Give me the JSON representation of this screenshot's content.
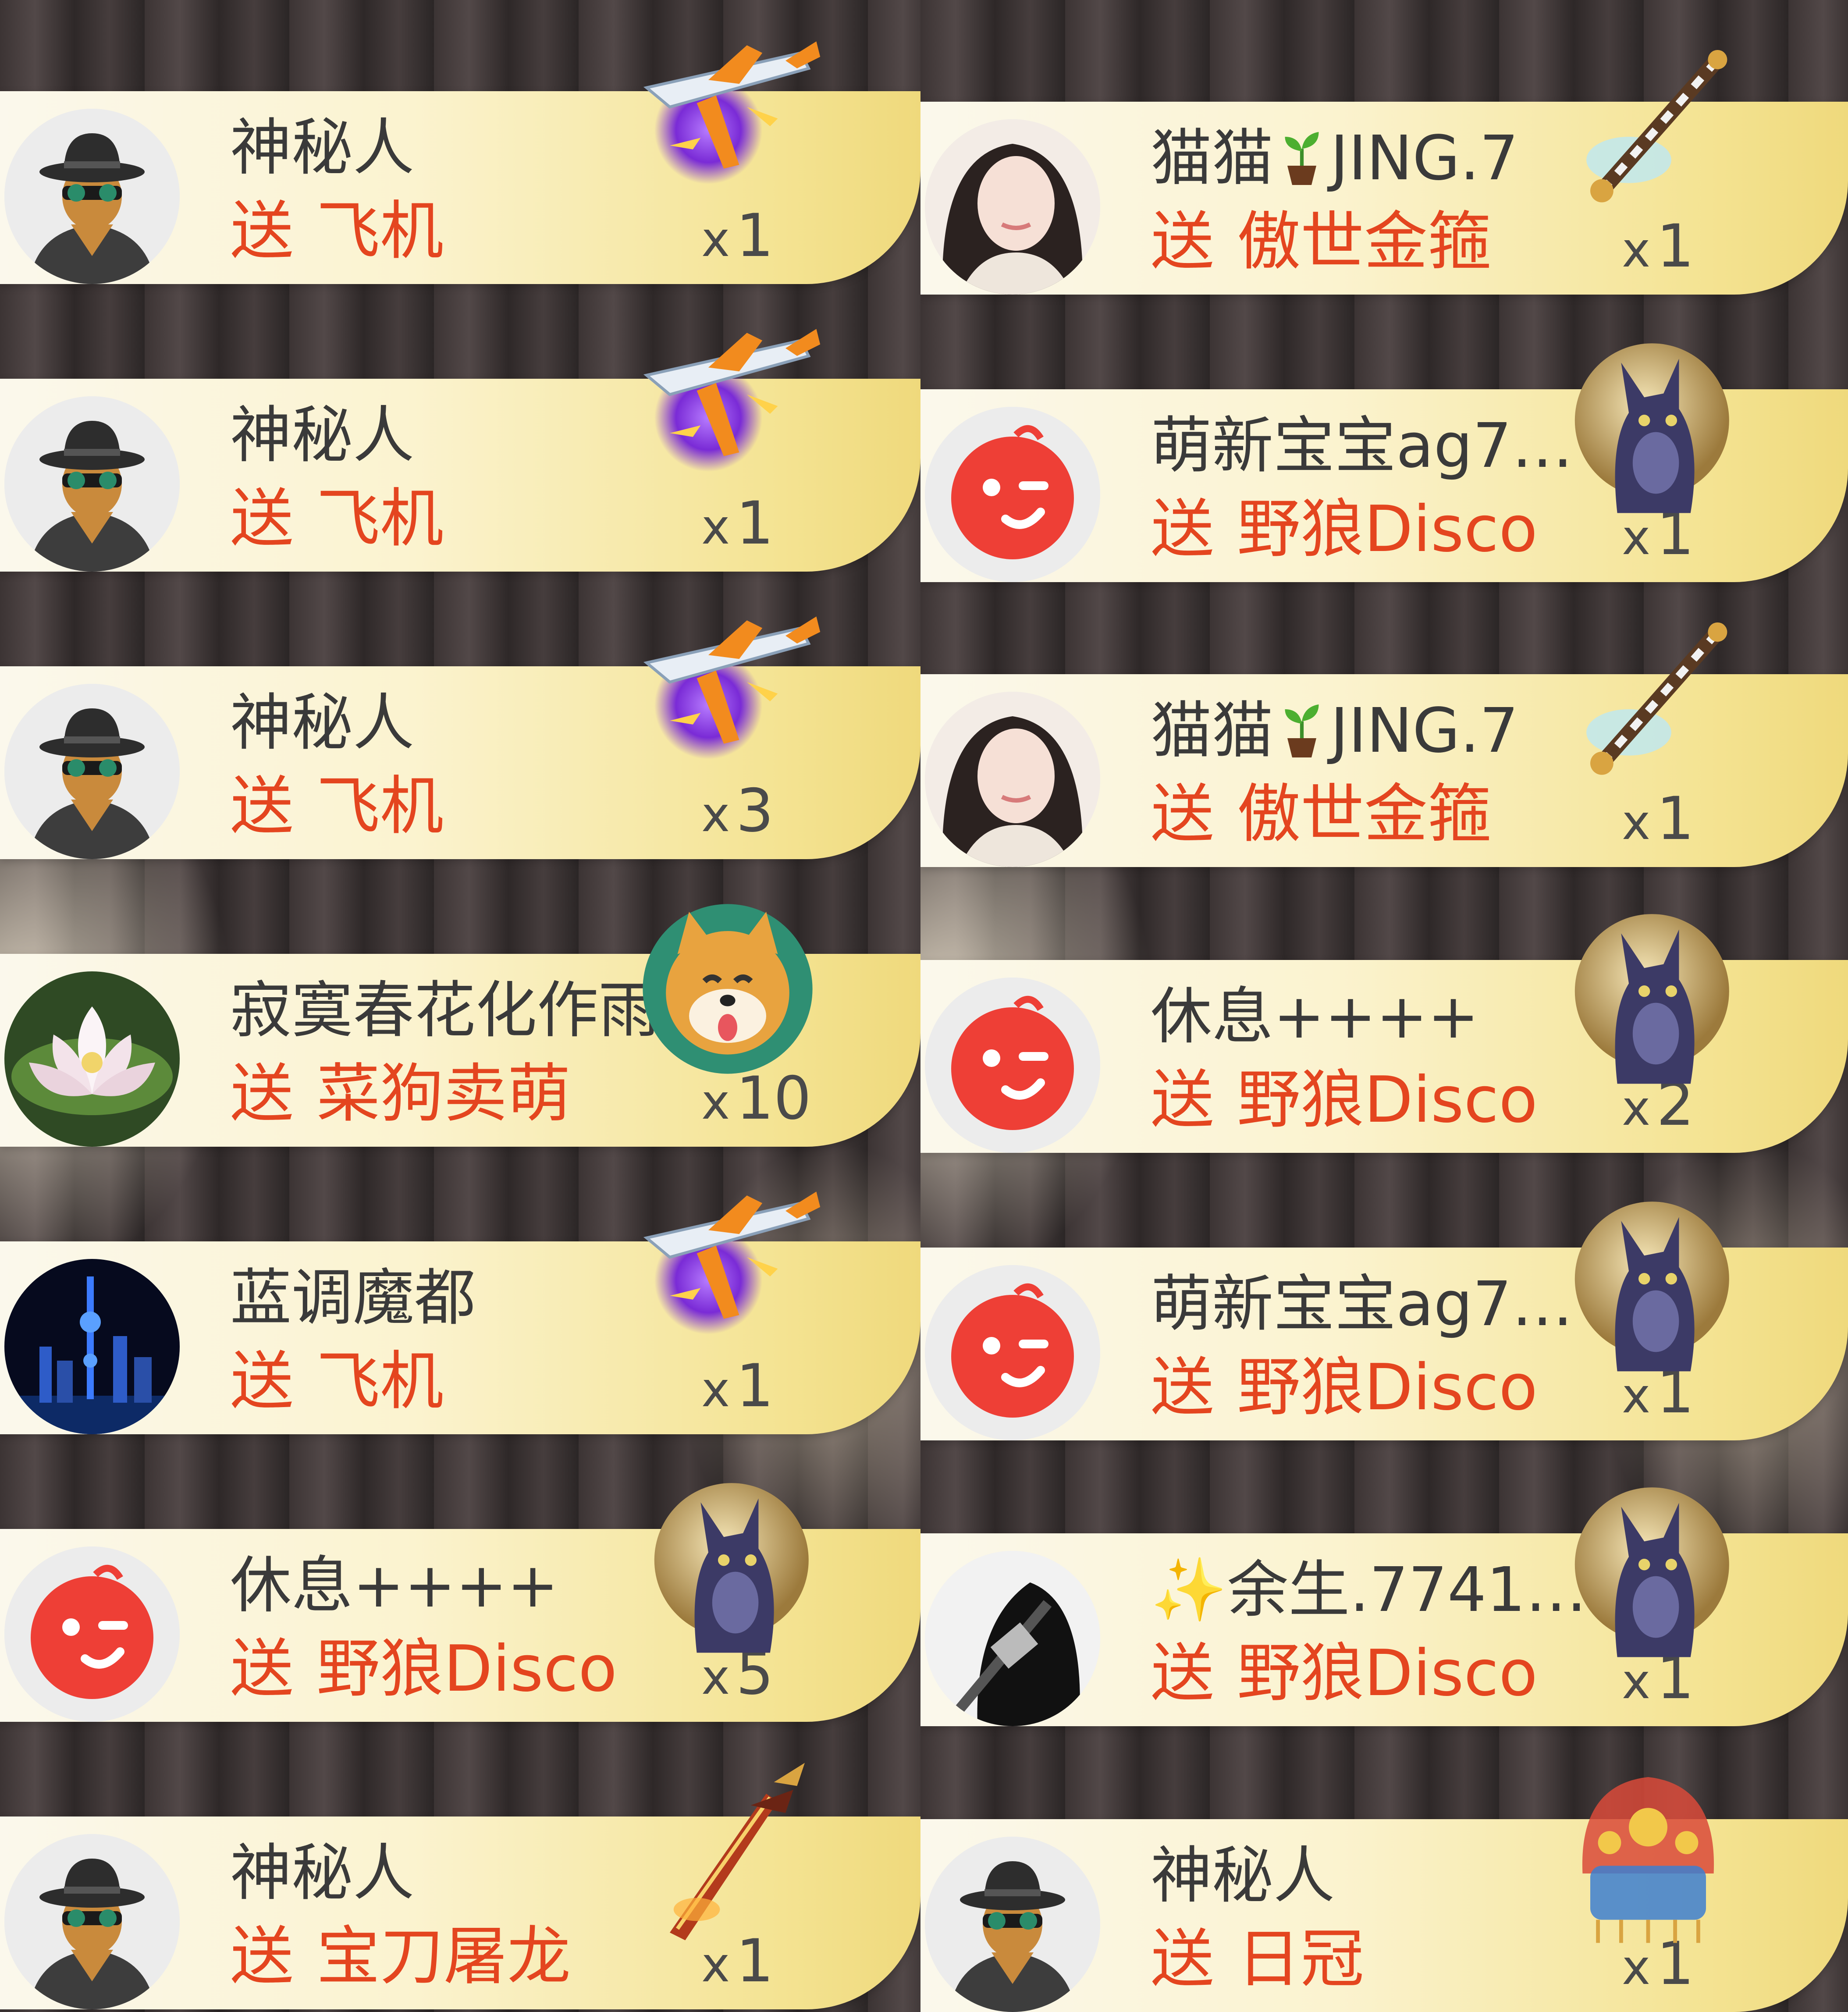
{
  "send_label": "送",
  "times_prefix": "x",
  "left_column": [
    {
      "user": "神秘人",
      "avatar": "spy-avatar-icon",
      "gift": "飞机",
      "gift_icon": "airplane-icon",
      "count": "1"
    },
    {
      "user": "神秘人",
      "avatar": "spy-avatar-icon",
      "gift": "飞机",
      "gift_icon": "airplane-icon",
      "count": "1"
    },
    {
      "user": "神秘人",
      "avatar": "spy-avatar-icon",
      "gift": "飞机",
      "gift_icon": "airplane-icon",
      "count": "3"
    },
    {
      "user": "寂寞春花化作雨",
      "avatar": "lotus-avatar",
      "gift": "菜狗卖萌",
      "gift_icon": "shiba-dog-icon",
      "count": "10"
    },
    {
      "user": "蓝调魔都",
      "avatar": "city-night-avatar",
      "gift": "飞机",
      "gift_icon": "airplane-icon",
      "count": "1"
    },
    {
      "user": "休息++++",
      "avatar": "wink-face-avatar",
      "gift": "野狼Disco",
      "gift_icon": "wolf-disco-icon",
      "count": "5"
    },
    {
      "user": "神秘人",
      "avatar": "spy-avatar-icon",
      "gift": "宝刀屠龙",
      "gift_icon": "dragon-sword-icon",
      "count": "1"
    }
  ],
  "right_column": [
    {
      "user_prefix": "猫猫",
      "user_suffix": "JING.7",
      "user_badge": "sprout-icon",
      "avatar": "girl-avatar",
      "gift": "傲世金箍",
      "gift_icon": "golden-staff-icon",
      "count": "1"
    },
    {
      "user": "萌新宝宝ag7…",
      "avatar": "wink-face-avatar",
      "gift": "野狼Disco",
      "gift_icon": "wolf-disco-icon",
      "count": "1"
    },
    {
      "user_prefix": "猫猫",
      "user_suffix": "JING.7",
      "user_badge": "sprout-icon",
      "avatar": "girl-avatar",
      "gift": "傲世金箍",
      "gift_icon": "golden-staff-icon",
      "count": "1"
    },
    {
      "user": "休息++++",
      "avatar": "wink-face-avatar",
      "gift": "野狼Disco",
      "gift_icon": "wolf-disco-icon",
      "count": "2"
    },
    {
      "user": "萌新宝宝ag7…",
      "avatar": "wink-face-avatar",
      "gift": "野狼Disco",
      "gift_icon": "wolf-disco-icon",
      "count": "1"
    },
    {
      "user_sparkle": "✨",
      "user": "余生.7741…",
      "avatar": "sketch-avatar",
      "gift": "野狼Disco",
      "gift_icon": "wolf-disco-icon",
      "count": "1"
    },
    {
      "user": "神秘人",
      "avatar": "spy-avatar-icon",
      "gift": "日冠",
      "gift_icon": "sun-crown-icon",
      "count": "1"
    }
  ]
}
